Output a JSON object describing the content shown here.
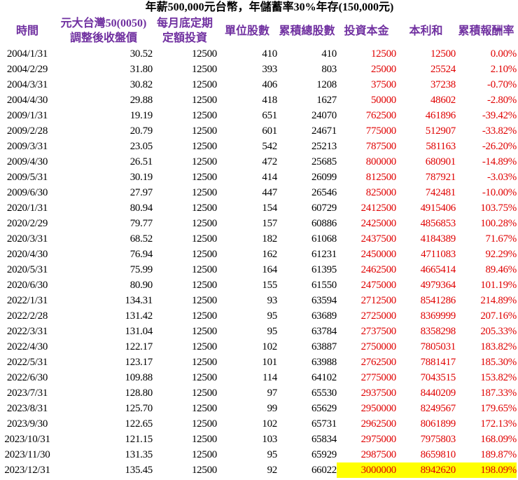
{
  "title": "年薪500,000元台幣，年儲蓄率30%年存(150,000元)",
  "headers": [
    {
      "line1": "時間",
      "line2": ""
    },
    {
      "line1": "元大台灣50(0050)",
      "line2": "調整後收盤價"
    },
    {
      "line1": "每月底定期",
      "line2": "定額投資"
    },
    {
      "line1": "單位股數",
      "line2": ""
    },
    {
      "line1": "累積總股數",
      "line2": ""
    },
    {
      "line1": "投資本金",
      "line2": ""
    },
    {
      "line1": "本利和",
      "line2": ""
    },
    {
      "line1": "累積報酬率",
      "line2": ""
    }
  ],
  "colors": {
    "header": "#7030A0",
    "red": "#e00000",
    "highlight": "#ffff00"
  },
  "rows": [
    [
      "2004/1/31",
      "30.52",
      "12500",
      "410",
      "410",
      "12500",
      "12500",
      "0.00%"
    ],
    [
      "2004/2/29",
      "31.80",
      "12500",
      "393",
      "803",
      "25000",
      "25524",
      "2.10%"
    ],
    [
      "2004/3/31",
      "30.82",
      "12500",
      "406",
      "1208",
      "37500",
      "37238",
      "-0.70%"
    ],
    [
      "2004/4/30",
      "29.88",
      "12500",
      "418",
      "1627",
      "50000",
      "48602",
      "-2.80%"
    ],
    [
      "2009/1/31",
      "19.19",
      "12500",
      "651",
      "24070",
      "762500",
      "461896",
      "-39.42%"
    ],
    [
      "2009/2/28",
      "20.79",
      "12500",
      "601",
      "24671",
      "775000",
      "512907",
      "-33.82%"
    ],
    [
      "2009/3/31",
      "23.05",
      "12500",
      "542",
      "25213",
      "787500",
      "581163",
      "-26.20%"
    ],
    [
      "2009/4/30",
      "26.51",
      "12500",
      "472",
      "25685",
      "800000",
      "680901",
      "-14.89%"
    ],
    [
      "2009/5/31",
      "30.19",
      "12500",
      "414",
      "26099",
      "812500",
      "787921",
      "-3.03%"
    ],
    [
      "2009/6/30",
      "27.97",
      "12500",
      "447",
      "26546",
      "825000",
      "742481",
      "-10.00%"
    ],
    [
      "2020/1/31",
      "80.94",
      "12500",
      "154",
      "60729",
      "2412500",
      "4915406",
      "103.75%"
    ],
    [
      "2020/2/29",
      "79.77",
      "12500",
      "157",
      "60886",
      "2425000",
      "4856853",
      "100.28%"
    ],
    [
      "2020/3/31",
      "68.52",
      "12500",
      "182",
      "61068",
      "2437500",
      "4184389",
      "71.67%"
    ],
    [
      "2020/4/30",
      "76.94",
      "12500",
      "162",
      "61231",
      "2450000",
      "4711083",
      "92.29%"
    ],
    [
      "2020/5/31",
      "75.99",
      "12500",
      "164",
      "61395",
      "2462500",
      "4665414",
      "89.46%"
    ],
    [
      "2020/6/30",
      "80.90",
      "12500",
      "155",
      "61550",
      "2475000",
      "4979364",
      "101.19%"
    ],
    [
      "2022/1/31",
      "134.31",
      "12500",
      "93",
      "63594",
      "2712500",
      "8541286",
      "214.89%"
    ],
    [
      "2022/2/28",
      "131.42",
      "12500",
      "95",
      "63689",
      "2725000",
      "8369999",
      "207.16%"
    ],
    [
      "2022/3/31",
      "131.04",
      "12500",
      "95",
      "63784",
      "2737500",
      "8358298",
      "205.33%"
    ],
    [
      "2022/4/30",
      "122.17",
      "12500",
      "102",
      "63887",
      "2750000",
      "7805031",
      "183.82%"
    ],
    [
      "2022/5/31",
      "123.17",
      "12500",
      "101",
      "63988",
      "2762500",
      "7881417",
      "185.30%"
    ],
    [
      "2022/6/30",
      "109.88",
      "12500",
      "114",
      "64102",
      "2775000",
      "7043515",
      "153.82%"
    ],
    [
      "2023/7/31",
      "128.80",
      "12500",
      "97",
      "65530",
      "2937500",
      "8440209",
      "187.33%"
    ],
    [
      "2023/8/31",
      "125.70",
      "12500",
      "99",
      "65629",
      "2950000",
      "8249567",
      "179.65%"
    ],
    [
      "2023/9/30",
      "122.65",
      "12500",
      "102",
      "65731",
      "2962500",
      "8061899",
      "172.13%"
    ],
    [
      "2023/10/31",
      "121.15",
      "12500",
      "103",
      "65834",
      "2975000",
      "7975803",
      "168.09%"
    ],
    [
      "2023/11/30",
      "131.35",
      "12500",
      "95",
      "65929",
      "2987500",
      "8659810",
      "189.87%"
    ],
    [
      "2023/12/31",
      "135.45",
      "12500",
      "92",
      "66022",
      "3000000",
      "8942620",
      "198.09%"
    ]
  ]
}
